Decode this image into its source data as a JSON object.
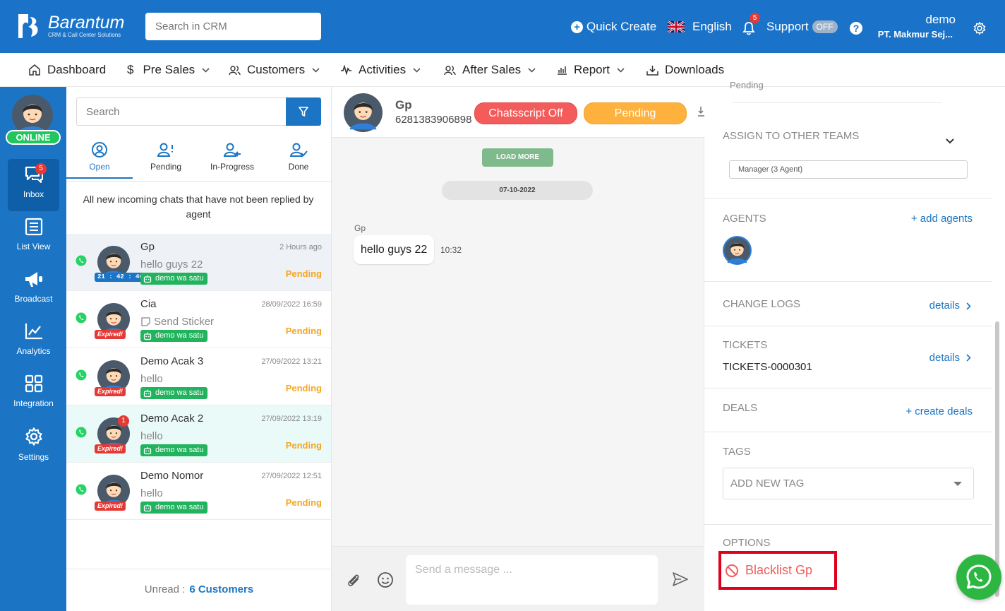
{
  "header": {
    "brand": "Barantum",
    "brand_sub": "CRM & Call Center Solutions",
    "search_placeholder": "Search in CRM",
    "quick_create": "Quick Create",
    "language": "English",
    "notif_count": "5",
    "support": "Support",
    "support_toggle": "OFF",
    "user_name": "demo",
    "company": "PT. Makmur Sej..."
  },
  "nav": [
    {
      "label": "Dashboard",
      "icon": "home-icon"
    },
    {
      "label": "Pre Sales",
      "icon": "dollar-icon"
    },
    {
      "label": "Customers",
      "icon": "users-icon"
    },
    {
      "label": "Activities",
      "icon": "activity-icon"
    },
    {
      "label": "After Sales",
      "icon": "users-icon"
    },
    {
      "label": "Report",
      "icon": "bar-chart-icon"
    },
    {
      "label": "Downloads",
      "icon": "download-icon"
    }
  ],
  "sidebar": {
    "status": "ONLINE",
    "items": [
      {
        "label": "Inbox",
        "badge": "5",
        "icon": "chat-icon"
      },
      {
        "label": "List View",
        "icon": "list-icon"
      },
      {
        "label": "Broadcast",
        "icon": "megaphone-icon"
      },
      {
        "label": "Analytics",
        "icon": "analytics-icon"
      },
      {
        "label": "Integration",
        "icon": "grid-icon"
      },
      {
        "label": "Settings",
        "icon": "gear-icon"
      }
    ]
  },
  "chat_list": {
    "search_placeholder": "Search",
    "tabs": [
      {
        "label": "Open",
        "icon": "user-circle-icon"
      },
      {
        "label": "Pending",
        "icon": "user-alert-icon"
      },
      {
        "label": "In-Progress",
        "icon": "user-progress-icon"
      },
      {
        "label": "Done",
        "icon": "user-check-icon"
      }
    ],
    "description": "All new incoming chats that have not been replied by agent",
    "rows": [
      {
        "name": "Gp",
        "time": "2 Hours ago",
        "message": "hello guys 22",
        "tag": "21 : 42 : 46",
        "channel": "demo wa satu",
        "status": "Pending"
      },
      {
        "name": "Cia",
        "time": "28/09/2022 16:59",
        "message": "Send Sticker",
        "tag": "Expired!",
        "channel": "demo wa satu",
        "status": "Pending"
      },
      {
        "name": "Demo Acak 3",
        "time": "27/09/2022 13:21",
        "message": "hello",
        "tag": "Expired!",
        "channel": "demo wa satu",
        "status": "Pending"
      },
      {
        "name": "Demo Acak 2",
        "time": "27/09/2022 13:19",
        "message": "hello",
        "tag": "Expired!",
        "badge": "1",
        "channel": "demo wa satu",
        "status": "Pending"
      },
      {
        "name": "Demo Nomor",
        "time": "27/09/2022 12:51",
        "message": "hello",
        "tag": "Expired!",
        "channel": "demo wa satu",
        "status": "Pending"
      }
    ],
    "footer_label": "Unread :",
    "footer_value": "6 Customers"
  },
  "conversation": {
    "name": "Gp",
    "phone": "6281383906898",
    "chatscript": "Chatsscript Off",
    "status": "Pending",
    "load_more": "LOAD MORE",
    "date": "07-10-2022",
    "sender": "Gp",
    "message": "hello guys 22",
    "message_time": "10:32",
    "input_placeholder": "Send a message ..."
  },
  "details": {
    "partial_text": "Pending",
    "assign_title": "ASSIGN TO OTHER TEAMS",
    "assign_value": "Manager (3 Agent)",
    "agents_title": "AGENTS",
    "agents_link": "+ add agents",
    "changelogs_title": "CHANGE LOGS",
    "changelogs_link": "details",
    "tickets_title": "TICKETS",
    "tickets_link": "details",
    "ticket_id": "TICKETS-0000301",
    "deals_title": "DEALS",
    "deals_link": "+ create deals",
    "tags_title": "TAGS",
    "tags_placeholder": "ADD NEW TAG",
    "options_title": "OPTIONS",
    "blacklist": "Blacklist Gp"
  },
  "colors": {
    "primary": "#1a73c8",
    "pending": "#f5a623",
    "danger": "#e53935",
    "whatsapp": "#2db742"
  }
}
